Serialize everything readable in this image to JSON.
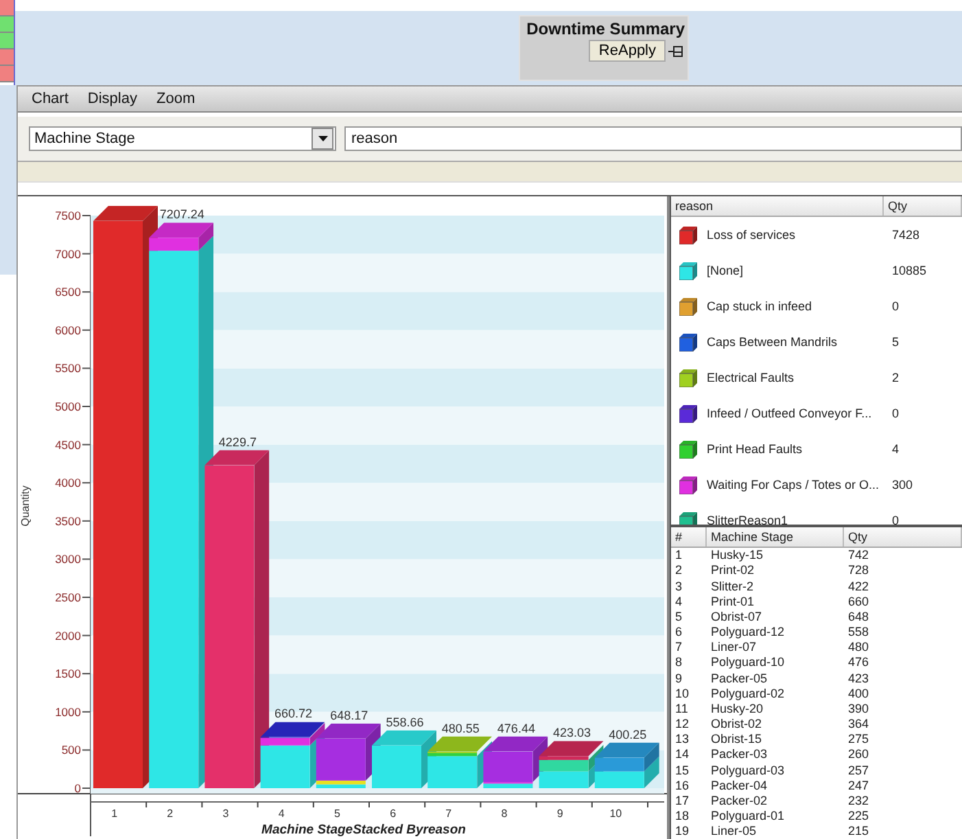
{
  "left_strip": [
    {
      "color": "#f08080"
    },
    {
      "color": "#70e070"
    },
    {
      "color": "#70e070"
    },
    {
      "color": "#f08080"
    },
    {
      "color": "#f08080"
    }
  ],
  "summary_panel": {
    "title": "Downtime Summary",
    "button": "ReApply"
  },
  "menu": [
    "Chart",
    "Display",
    "Zoom"
  ],
  "toolbar": {
    "group_by": "Machine Stage",
    "stack_by": "reason"
  },
  "chart": {
    "chart_data": {
      "type": "bar",
      "stacked": true,
      "xlabel": "Machine StageStacked Byreason",
      "ylabel": "Quantity",
      "categories": [
        "1",
        "2",
        "3",
        "4",
        "5",
        "6",
        "7",
        "8",
        "9",
        "10"
      ],
      "ylim": [
        0,
        7500
      ],
      "yticks": [
        0,
        500,
        1000,
        1500,
        2000,
        2500,
        3000,
        3500,
        4000,
        4500,
        5000,
        5500,
        6000,
        6500,
        7000,
        7500
      ],
      "series": [
        {
          "color": "#2ee6e6",
          "values": [
            0,
            7040,
            0,
            560,
            50,
            560,
            420,
            60,
            220,
            220
          ]
        },
        {
          "color": "#e02a2a",
          "values": [
            7430,
            0,
            0,
            0,
            0,
            0,
            0,
            0,
            0,
            0
          ]
        },
        {
          "color": "#e4306a",
          "values": [
            0,
            0,
            4230,
            0,
            0,
            0,
            0,
            0,
            0,
            0
          ]
        },
        {
          "color": "#e8e020",
          "values": [
            0,
            0,
            0,
            0,
            50,
            0,
            0,
            0,
            0,
            0
          ]
        },
        {
          "color": "#30d040",
          "values": [
            0,
            0,
            0,
            0,
            0,
            0,
            40,
            0,
            0,
            0
          ]
        },
        {
          "color": "#30d8a0",
          "values": [
            0,
            0,
            0,
            0,
            0,
            0,
            0,
            0,
            150,
            0
          ]
        },
        {
          "color": "#e030e0",
          "values": [
            0,
            170,
            0,
            100,
            0,
            0,
            0,
            20,
            0,
            0
          ]
        },
        {
          "color": "#a62ee0",
          "values": [
            0,
            0,
            0,
            0,
            550,
            0,
            0,
            400,
            0,
            0
          ]
        },
        {
          "color": "#2a2ad0",
          "values": [
            0,
            0,
            0,
            10,
            0,
            0,
            0,
            0,
            0,
            0
          ]
        },
        {
          "color": "#a0d020",
          "values": [
            0,
            0,
            0,
            0,
            0,
            0,
            20,
            0,
            0,
            0
          ]
        },
        {
          "color": "#d02a5a",
          "values": [
            0,
            0,
            0,
            0,
            0,
            0,
            0,
            0,
            50,
            0
          ]
        },
        {
          "color": "#2a9ad8",
          "values": [
            0,
            0,
            0,
            0,
            0,
            0,
            0,
            0,
            0,
            180
          ]
        }
      ],
      "value_labels": [
        null,
        "7207.24",
        "4229.7",
        "660.72",
        "648.17",
        "558.66",
        "480.55",
        "476.44",
        "423.03",
        "400.25"
      ]
    }
  },
  "legend": {
    "columns": [
      "reason",
      "Qty"
    ],
    "rows": [
      {
        "reason": "Loss of services",
        "qty": "7428",
        "color": "#e02a2a"
      },
      {
        "reason": "[None]",
        "qty": "10885",
        "color": "#2ee6e6"
      },
      {
        "reason": "Cap stuck in infeed",
        "qty": "0",
        "color": "#e0a030"
      },
      {
        "reason": "Caps Between Mandrils",
        "qty": "5",
        "color": "#2060e0"
      },
      {
        "reason": "Electrical Faults",
        "qty": "2",
        "color": "#a0d020"
      },
      {
        "reason": "Infeed / Outfeed Conveyor F...",
        "qty": "0",
        "color": "#5a2ad8"
      },
      {
        "reason": "Print Head Faults",
        "qty": "4",
        "color": "#30d030"
      },
      {
        "reason": "Waiting For Caps / Totes or O...",
        "qty": "300",
        "color": "#e030e0"
      },
      {
        "reason": "SlitterReason1",
        "qty": "0",
        "color": "#20c090"
      }
    ]
  },
  "stage_table": {
    "columns": [
      "#",
      "Machine Stage",
      "Qty"
    ],
    "rows": [
      [
        "1",
        "Husky-15",
        "742"
      ],
      [
        "2",
        "Print-02",
        "728"
      ],
      [
        "3",
        "Slitter-2",
        "422"
      ],
      [
        "4",
        "Print-01",
        "660"
      ],
      [
        "5",
        "Obrist-07",
        "648"
      ],
      [
        "6",
        "Polyguard-12",
        "558"
      ],
      [
        "7",
        "Liner-07",
        "480"
      ],
      [
        "8",
        "Polyguard-10",
        "476"
      ],
      [
        "9",
        "Packer-05",
        "423"
      ],
      [
        "10",
        "Polyguard-02",
        "400"
      ],
      [
        "11",
        "Husky-20",
        "390"
      ],
      [
        "12",
        "Obrist-02",
        "364"
      ],
      [
        "13",
        "Obrist-15",
        "275"
      ],
      [
        "14",
        "Packer-03",
        "260"
      ],
      [
        "15",
        "Polyguard-03",
        "257"
      ],
      [
        "16",
        "Packer-04",
        "247"
      ],
      [
        "17",
        "Packer-02",
        "232"
      ],
      [
        "18",
        "Polyguard-01",
        "225"
      ],
      [
        "19",
        "Liner-05",
        "215"
      ]
    ]
  }
}
